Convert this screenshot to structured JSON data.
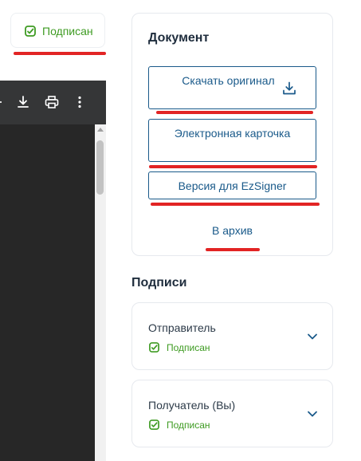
{
  "status_pill": {
    "label": "Подписан",
    "icon": "signed-check-icon",
    "color": "#3e9b22"
  },
  "viewer": {
    "toolbar_icons": [
      "download-icon",
      "print-icon",
      "more-vertical-icon"
    ]
  },
  "document": {
    "title": "Документ",
    "download_label": "Скачать оригинал",
    "card_label": "Электронная карточка",
    "ezsigner_label": "Версия для EzSigner",
    "archive_label": "В архив"
  },
  "signatures": {
    "title": "Подписи",
    "items": [
      {
        "name": "Отправитель",
        "status": "Подписан"
      },
      {
        "name": "Получатель (Вы)",
        "status": "Подписан"
      }
    ]
  },
  "colors": {
    "accent": "#1a5a8a",
    "signed": "#3e9b22",
    "annotation": "#e22424",
    "viewer_dark": "#272727"
  }
}
